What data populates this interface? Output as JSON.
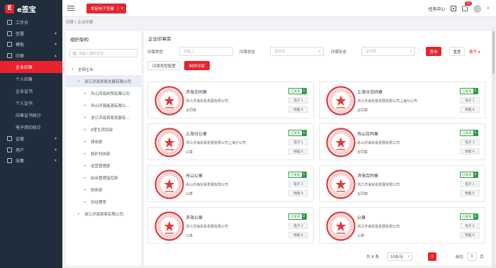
{
  "app": {
    "logo_text": "e签宝",
    "logo_mark": "E"
  },
  "sidebar": {
    "items": [
      {
        "label": "工作台",
        "icon": "home-icon",
        "has_children": false
      },
      {
        "label": "签署",
        "icon": "sign-icon",
        "has_children": true
      },
      {
        "label": "模板",
        "icon": "template-icon",
        "has_children": true
      },
      {
        "label": "印章",
        "icon": "seal-icon",
        "has_children": true,
        "expanded": true
      }
    ],
    "seal_sub": [
      {
        "label": "企业印章",
        "active": true
      },
      {
        "label": "个人印章",
        "active": false
      },
      {
        "label": "企业证书",
        "active": false
      },
      {
        "label": "个人证书",
        "active": false
      },
      {
        "label": "印章证书统计",
        "active": false
      },
      {
        "label": "电子用印统计",
        "active": false
      }
    ],
    "items_after": [
      {
        "label": "证据",
        "icon": "evidence-icon",
        "has_children": true
      },
      {
        "label": "用户",
        "icon": "user-icon",
        "has_children": true
      },
      {
        "label": "采集",
        "icon": "collect-icon",
        "has_children": true
      }
    ]
  },
  "topbar": {
    "start_button": "发起电子签署",
    "task_center": "任务中心",
    "notification_count": "10"
  },
  "breadcrumb": "印章 / 企业印章",
  "org": {
    "title": "组织架构",
    "search_placeholder": "请输入组织名称",
    "tree": [
      {
        "label": "全部企业",
        "level": 0,
        "arrow": "down",
        "selected": false
      },
      {
        "label": "浙江济海贸易发展有限公司",
        "level": 1,
        "arrow": "down",
        "selected": true
      },
      {
        "label": "舟山济海邦贸有限公司",
        "level": 2,
        "arrow": "right",
        "selected": false
      },
      {
        "label": "舟山济海能源有限公...",
        "level": 2,
        "arrow": "right",
        "selected": false
      },
      {
        "label": "浙江济海贸易发展有...",
        "level": 2,
        "arrow": "right",
        "selected": false
      },
      {
        "label": "8室生项目部",
        "level": 2,
        "arrow": "right",
        "selected": false
      },
      {
        "label": "煤炭部",
        "level": 2,
        "arrow": "right",
        "selected": false
      },
      {
        "label": "铁矿科技部",
        "level": 2,
        "arrow": "right",
        "selected": false
      },
      {
        "label": "运营管理部",
        "level": 2,
        "arrow": "right",
        "selected": false
      },
      {
        "label": "综合管理监控部",
        "level": 2,
        "arrow": "right",
        "selected": false
      },
      {
        "label": "财务部",
        "level": 2,
        "arrow": "right",
        "selected": false
      },
      {
        "label": "总经理室",
        "level": 2,
        "arrow": "right",
        "selected": false
      },
      {
        "label": "浙江济海贸易有限公司",
        "level": 1,
        "arrow": "right",
        "selected": false
      }
    ]
  },
  "main": {
    "title": "企业印章库",
    "filters": {
      "seal_type_label": "印章类型",
      "seal_type_placeholder": "请输入",
      "seal_status_label": "印章状态",
      "seal_status_placeholder": "请选择",
      "seal_form_label": "印章形态",
      "seal_form_placeholder": "请选择",
      "query": "查询",
      "reset": "重置",
      "expand": "展开"
    },
    "actions": {
      "config": "印章类型配置",
      "make": "制作印章"
    },
    "cards": [
      {
        "name": "济海合同章",
        "company": "浙江济海贸易发展有限公司",
        "type": "合同章",
        "status": "已发布",
        "status_count": "1",
        "e_count": "电子 1",
        "p_count": "物理 0"
      },
      {
        "name": "上海分合同章",
        "company": "浙江济海贸易发展有限公司上海分公司",
        "type": "合同章",
        "status": "已发布",
        "status_count": "1",
        "e_count": "电子 1",
        "p_count": "物理 0"
      },
      {
        "name": "上海分公章",
        "company": "浙江济海贸易发展有限公司上海分公司",
        "type": "公章",
        "status": "已发布",
        "status_count": "1",
        "e_count": "电子 1",
        "p_count": "物理 0"
      },
      {
        "name": "舟山合同章",
        "company": "舟山济海贸易发展有限公司",
        "type": "合同章",
        "status": "已发布",
        "status_count": "1",
        "e_count": "电子 1",
        "p_count": "物理 0"
      },
      {
        "name": "舟山公章",
        "company": "舟山济海贸易发展有限公司",
        "type": "公章",
        "status": "已发布",
        "status_count": "1",
        "e_count": "电子 1",
        "p_count": "物理 0"
      },
      {
        "name": "济海合同章",
        "company": "浙江济海贸易发展有限公司",
        "type": "合同章",
        "status": "已发布",
        "status_count": "1",
        "e_count": "电子 1",
        "p_count": "物理 0"
      },
      {
        "name": "济海公章",
        "company": "浙江济海贸易发展有限公司",
        "type": "公章",
        "status": "已发布",
        "status_count": "2",
        "e_count": "电子 2",
        "p_count": "物理 0"
      },
      {
        "name": "公章",
        "company": "浙江济海贸易发展有限公司",
        "type": "公章",
        "status": "已发布",
        "status_count": "2",
        "e_count": "电子 2",
        "p_count": "物理 0"
      }
    ],
    "pagination": {
      "total": "共 8 条",
      "page_size": "10条/页",
      "prev": "‹",
      "current": "1",
      "next": "›",
      "goto_label": "前往",
      "goto_value": "1",
      "goto_suffix": "页"
    }
  },
  "colors": {
    "brand": "#e8232d",
    "sidebar_bg": "#1f2d3d",
    "published": "#2f9e44"
  }
}
